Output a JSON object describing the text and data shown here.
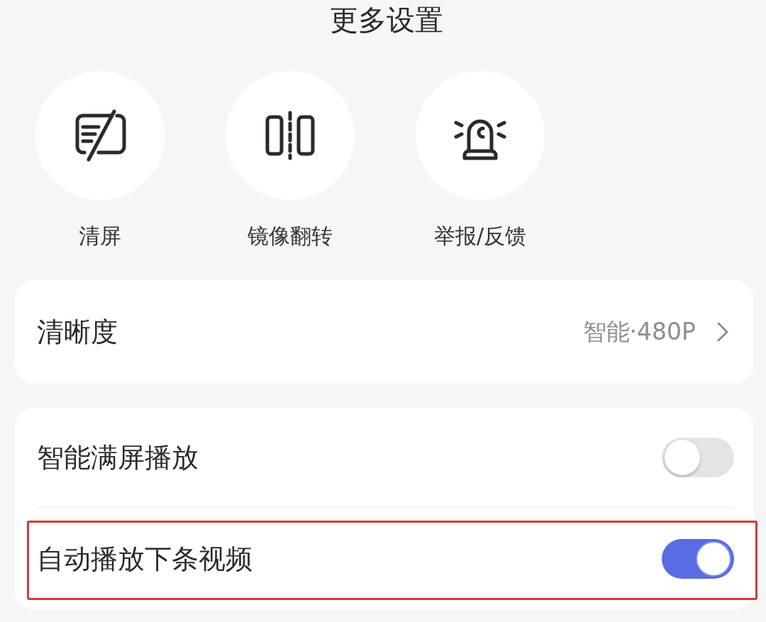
{
  "title": "更多设置",
  "actions": [
    {
      "kind": "clear_screen",
      "label": "清屏"
    },
    {
      "kind": "mirror",
      "label": "镜像翻转"
    },
    {
      "kind": "report",
      "label": "举报/反馈"
    }
  ],
  "quality": {
    "label": "清晰度",
    "value": "智能·480P"
  },
  "toggles": [
    {
      "label": "智能满屏播放",
      "on": false,
      "highlighted": false
    },
    {
      "label": "自动播放下条视频",
      "on": true,
      "highlighted": true
    }
  ]
}
